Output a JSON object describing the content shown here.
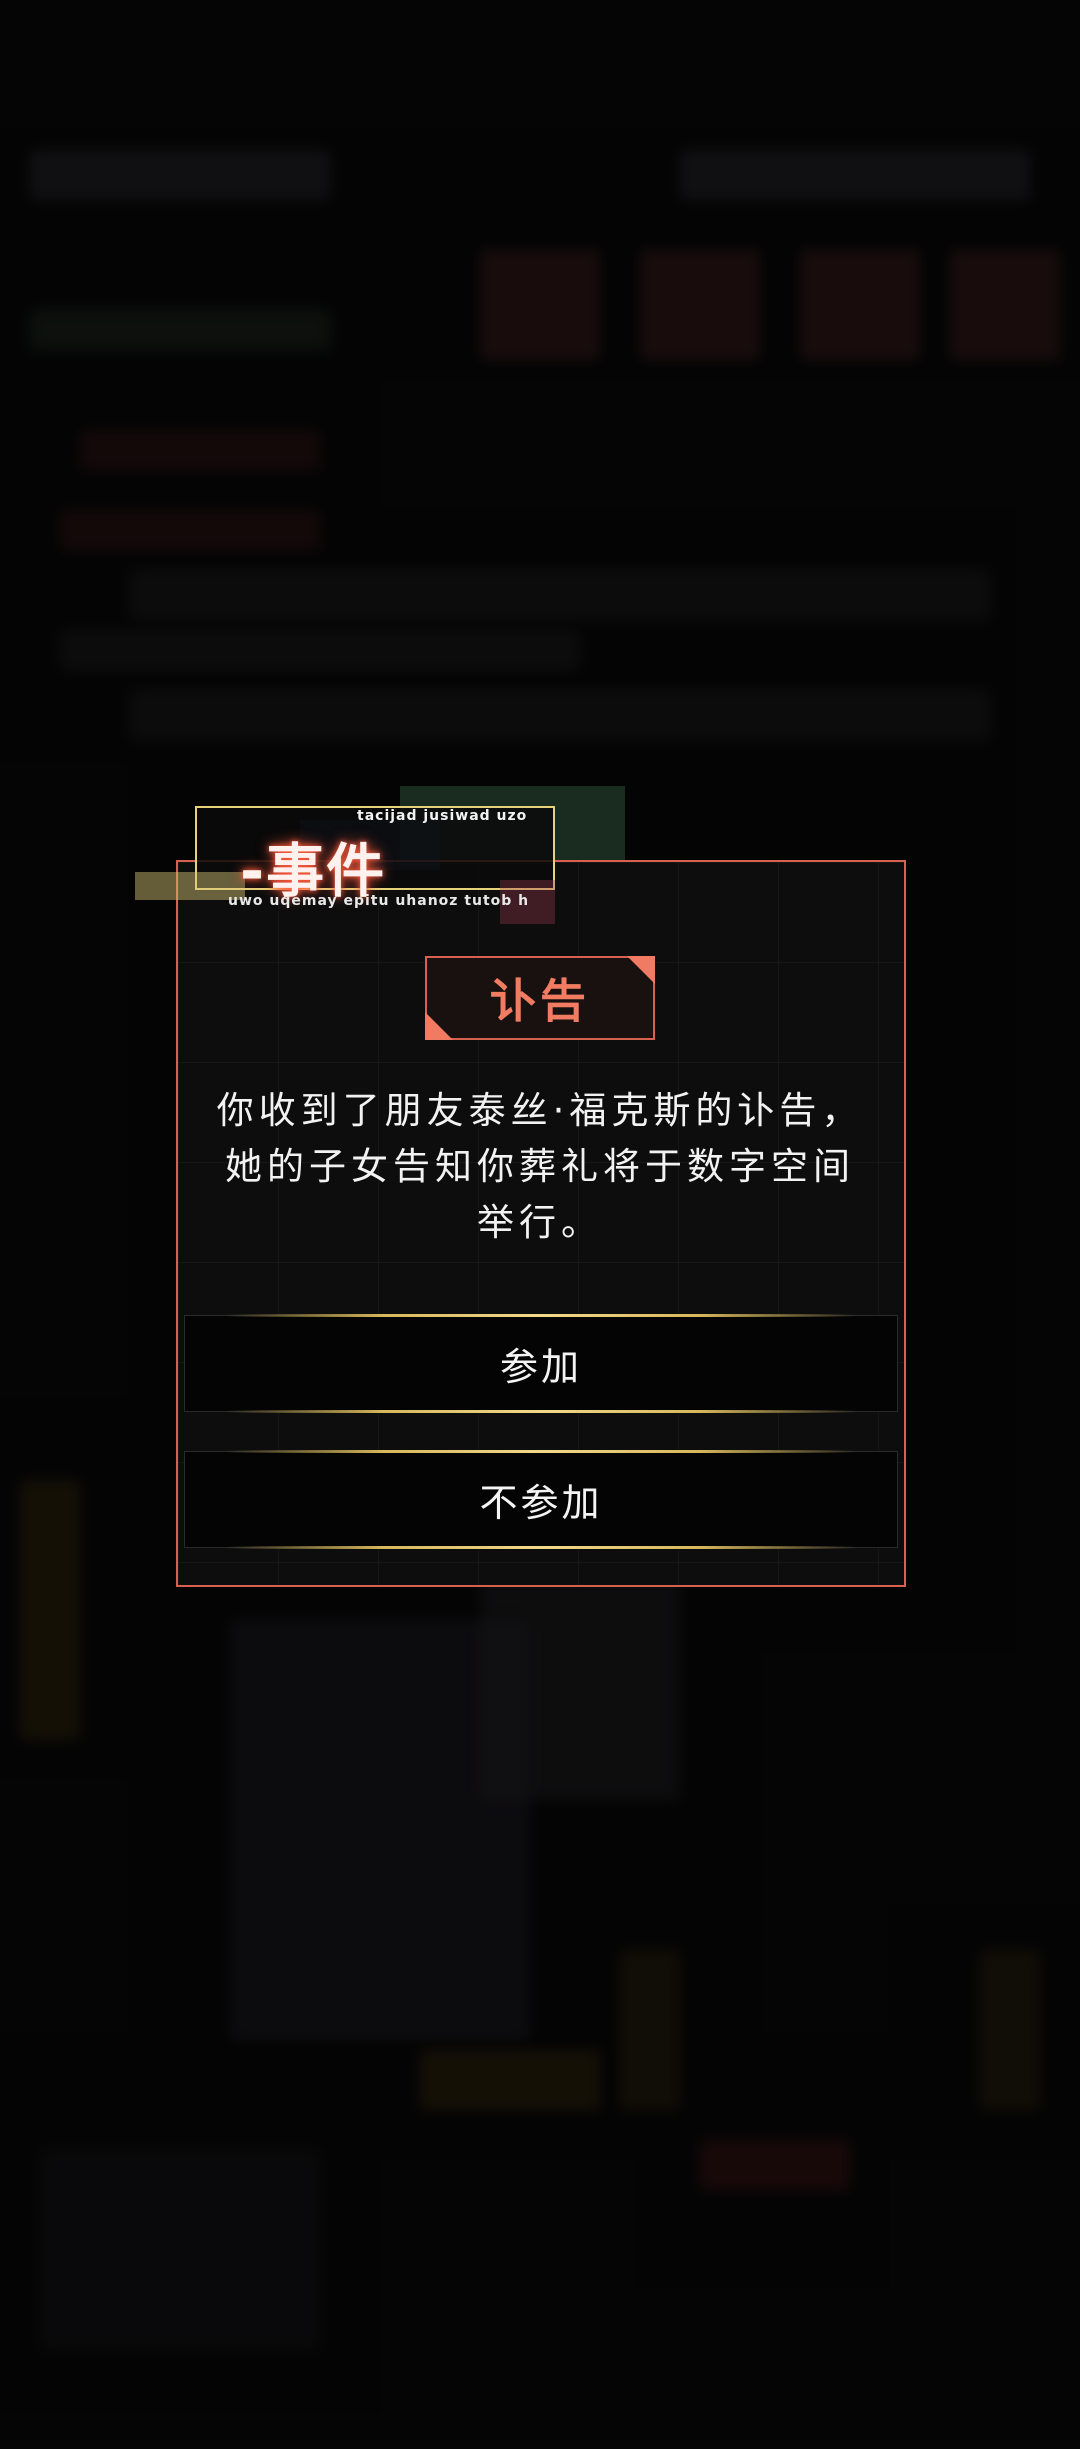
{
  "event": {
    "top_code": "tacijad jusiwad uzo",
    "title": "-事件",
    "bottom_code": "uwo uqemay epitu uhanoz tutob h"
  },
  "dialog": {
    "badge": "讣告",
    "message": "你收到了朋友泰丝·福克斯的讣告，她的子女告知你葬礼将于数字空间举行。",
    "choices": [
      {
        "label": "参加"
      },
      {
        "label": "不参加"
      }
    ]
  },
  "colors": {
    "accent": "#d8604e",
    "badge_text": "#f27c62",
    "gold": "#e6d27a",
    "title_glow": "#ff5a3c"
  }
}
